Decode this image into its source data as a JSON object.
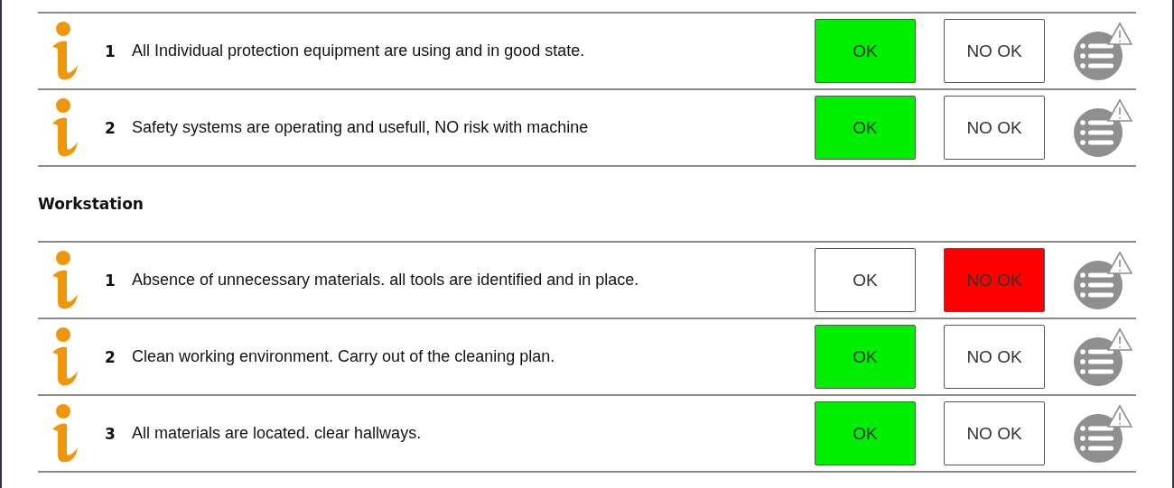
{
  "sections": [
    {
      "items": [
        {
          "number": "1",
          "text": "All Individual protection equipment are using and in good state.",
          "options": [
            {
              "kind": "ok",
              "label": "OK",
              "selected": true
            },
            {
              "kind": "nok",
              "label": "NO OK",
              "selected": false
            }
          ]
        },
        {
          "number": "2",
          "text": "Safety systems are operating and usefull, NO risk with machine",
          "options": [
            {
              "kind": "ok",
              "label": "OK",
              "selected": true
            },
            {
              "kind": "nok",
              "label": "NO OK",
              "selected": false
            }
          ]
        }
      ]
    },
    {
      "title": "Workstation",
      "items": [
        {
          "number": "1",
          "text": "Absence of unnecessary materials. all tools are identified and in place.",
          "options": [
            {
              "kind": "ok",
              "label": "OK",
              "selected": false
            },
            {
              "kind": "nok",
              "label": "NO OK",
              "selected": true
            }
          ]
        },
        {
          "number": "2",
          "text": "Clean working environment. Carry out of the cleaning plan.",
          "options": [
            {
              "kind": "ok",
              "label": "OK",
              "selected": true
            },
            {
              "kind": "nok",
              "label": "NO OK",
              "selected": false
            }
          ]
        },
        {
          "number": "3",
          "text": "All materials are located. clear hallways.",
          "options": [
            {
              "kind": "ok",
              "label": "OK",
              "selected": true
            },
            {
              "kind": "nok",
              "label": "NO OK",
              "selected": false
            }
          ]
        }
      ]
    }
  ]
}
